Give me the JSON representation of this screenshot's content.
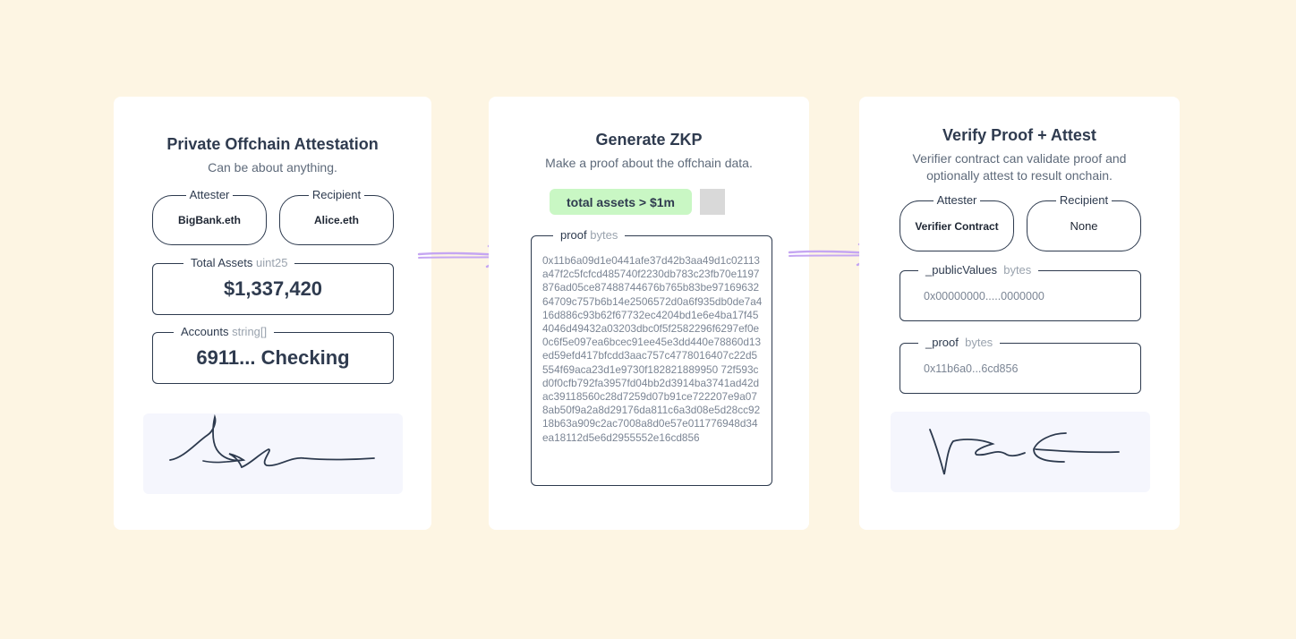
{
  "colors": {
    "background": "#fdf5e3",
    "card": "#ffffff",
    "ink": "#2d3a4e",
    "muted": "#7b8594",
    "chip": "#c9f7c4",
    "signature_bg": "#f5f6fd",
    "arrow": "#c5a6f2"
  },
  "steps": [
    {
      "title": "Private Offchain Attestation",
      "subtitle": "Can be about anything.",
      "attester": {
        "label": "Attester",
        "value": "BigBank.eth"
      },
      "recipient": {
        "label": "Recipient",
        "value": "Alice.eth"
      },
      "fields": [
        {
          "name": "Total Assets",
          "type": "uint25",
          "value": "$1,337,420"
        },
        {
          "name": "Accounts",
          "type": "string[]",
          "value": "6911... Checking"
        }
      ],
      "signature_icon": "handwritten-signature"
    },
    {
      "title": "Generate ZKP",
      "subtitle": "Make a proof about the offchain data.",
      "claim": "total assets > $1m",
      "proof": {
        "name": "proof",
        "type": "bytes",
        "value": "0x11b6a09d1e0441afe37d42b3aa49d1c02113a47f2c5fcfcd485740f2230db783c23fb70e1197876ad05ce87488744676b765b83be9716963264709c757b6b14e2506572d0a6f935db0de7a416d886c93b62f67732ec4204bd1e6e4ba17f454046d49432a03203dbc0f5f2582296f6297ef0e0c6f5e097ea6bcec91ee45e3dd440e78860d13ed59efd417bfcdd3aac757c4778016407c22d5554f69aca23d1e9730f182821889950 72f593cd0f0cfb792fa3957fd04bb2d3914ba3741ad42dac39118560c28d7259d07b91ce722207e9a078ab50f9a2a8d29176da811c6a3d08e5d28cc9218b63a909c2ac7008a8d0e57e011776948d34ea18112d5e6d2955552e16cd856"
      }
    },
    {
      "title": "Verify Proof + Attest",
      "subtitle_lines": [
        "Verifier contract can validate proof and",
        "optionally attest to result onchain."
      ],
      "attester": {
        "label": "Attester",
        "value": "Verifier Contract"
      },
      "recipient": {
        "label": "Recipient",
        "value": "None"
      },
      "fields": [
        {
          "name": "_publicValues",
          "type": "bytes",
          "value": "0x00000000.....0000000"
        },
        {
          "name": "_proof",
          "type": "bytes",
          "value": "0x11b6a0...6cd856"
        }
      ],
      "signature_icon": "handwritten-signature"
    }
  ],
  "arrows": [
    "arrow-right-icon",
    "arrow-right-icon"
  ]
}
